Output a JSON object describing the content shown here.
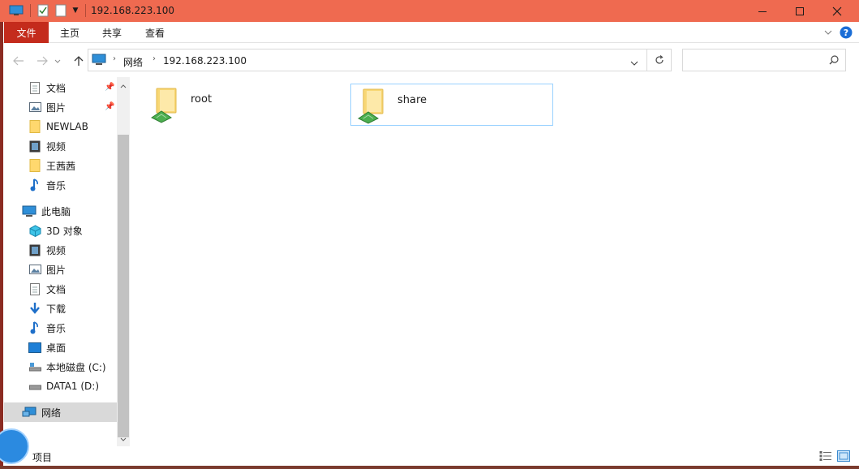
{
  "window": {
    "title": "192.168.223.100",
    "controls": {
      "minimize": "—",
      "maximize": "☐",
      "close": "✕"
    }
  },
  "ribbon": {
    "tabs": [
      "文件",
      "主页",
      "共享",
      "查看"
    ]
  },
  "address": {
    "crumbs": [
      "网络",
      "192.168.223.100"
    ],
    "search_placeholder": ""
  },
  "sidebar": {
    "items": [
      {
        "label": "文档",
        "icon": "document-icon",
        "pinned": true
      },
      {
        "label": "图片",
        "icon": "picture-icon",
        "pinned": true
      },
      {
        "label": "NEWLAB",
        "icon": "folder-icon"
      },
      {
        "label": "视频",
        "icon": "video-icon"
      },
      {
        "label": "王茜茜",
        "icon": "folder-icon"
      },
      {
        "label": "音乐",
        "icon": "music-icon"
      },
      {
        "label": "此电脑",
        "icon": "computer-icon"
      },
      {
        "label": "3D 对象",
        "icon": "3d-objects-icon"
      },
      {
        "label": "视频",
        "icon": "video-icon"
      },
      {
        "label": "图片",
        "icon": "picture-icon"
      },
      {
        "label": "文档",
        "icon": "document-icon"
      },
      {
        "label": "下载",
        "icon": "download-icon"
      },
      {
        "label": "音乐",
        "icon": "music-icon"
      },
      {
        "label": "桌面",
        "icon": "desktop-icon"
      },
      {
        "label": "本地磁盘 (C:)",
        "icon": "drive-icon"
      },
      {
        "label": "DATA1 (D:)",
        "icon": "drive-icon"
      },
      {
        "label": "网络",
        "icon": "network-icon"
      }
    ]
  },
  "content": {
    "items": [
      {
        "name": "root",
        "icon": "shared-folder-icon"
      },
      {
        "name": "share",
        "icon": "shared-folder-icon"
      }
    ]
  },
  "status": {
    "count_text": "项目"
  },
  "colors": {
    "titlebar": "#ef6a50",
    "file_tab": "#c42b1c",
    "selection": "#99d1ff",
    "help": "#1a6dd6"
  }
}
